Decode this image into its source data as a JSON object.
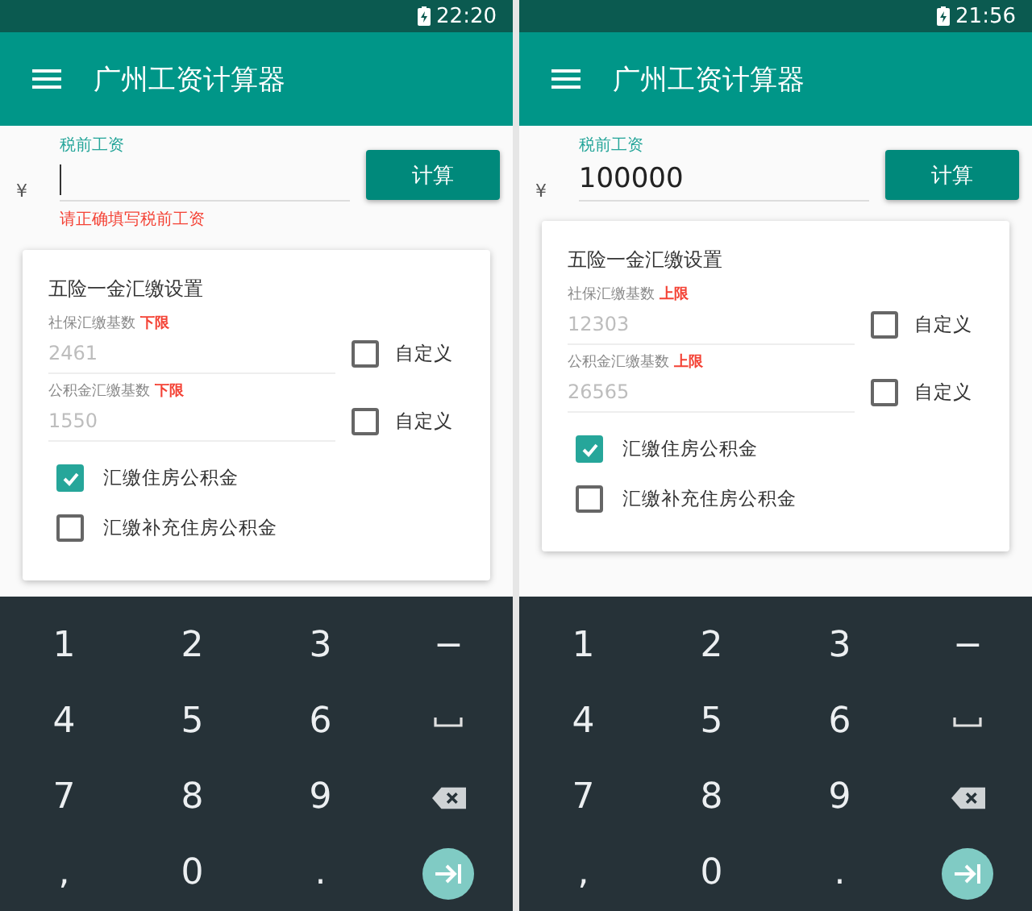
{
  "phones": [
    {
      "status_time": "22:20",
      "app_title": "广州工资计算器",
      "salary": {
        "label": "税前工资",
        "currency": "¥",
        "focused": true,
        "error": "请正确填写税前工资"
      },
      "calculate_button": "计算",
      "settings": {
        "title": "五险一金汇缴设置",
        "bases": [
          {
            "label": "社保汇缴基数",
            "limit": "下限",
            "placeholder": "2461",
            "custom": {
              "label": "自定义",
              "checked": false
            }
          },
          {
            "label": "公积金汇缴基数",
            "limit": "下限",
            "placeholder": "1550",
            "custom": {
              "label": "自定义",
              "checked": false
            }
          }
        ],
        "options": [
          {
            "label": "汇缴住房公积金",
            "checked": true
          },
          {
            "label": "汇缴补充住房公积金",
            "checked": false
          }
        ]
      },
      "keys": [
        {
          "kind": "char",
          "label": "1"
        },
        {
          "kind": "char",
          "label": "2"
        },
        {
          "kind": "char",
          "label": "3"
        },
        {
          "kind": "char",
          "label": "−"
        },
        {
          "kind": "char",
          "label": "4"
        },
        {
          "kind": "char",
          "label": "5"
        },
        {
          "kind": "char",
          "label": "6"
        },
        {
          "kind": "space"
        },
        {
          "kind": "char",
          "label": "7"
        },
        {
          "kind": "char",
          "label": "8"
        },
        {
          "kind": "char",
          "label": "9"
        },
        {
          "kind": "backspace"
        },
        {
          "kind": "char",
          "label": ","
        },
        {
          "kind": "char",
          "label": "0"
        },
        {
          "kind": "char",
          "label": "."
        },
        {
          "kind": "next"
        }
      ]
    },
    {
      "status_time": "21:56",
      "app_title": "广州工资计算器",
      "salary": {
        "label": "税前工资",
        "currency": "¥",
        "value": "100000",
        "focused": false
      },
      "calculate_button": "计算",
      "settings": {
        "title": "五险一金汇缴设置",
        "bases": [
          {
            "label": "社保汇缴基数",
            "limit": "上限",
            "placeholder": "12303",
            "custom": {
              "label": "自定义",
              "checked": false
            }
          },
          {
            "label": "公积金汇缴基数",
            "limit": "上限",
            "placeholder": "26565",
            "custom": {
              "label": "自定义",
              "checked": false
            }
          }
        ],
        "options": [
          {
            "label": "汇缴住房公积金",
            "checked": true
          },
          {
            "label": "汇缴补充住房公积金",
            "checked": false
          }
        ]
      },
      "keys": [
        {
          "kind": "char",
          "label": "1"
        },
        {
          "kind": "char",
          "label": "2"
        },
        {
          "kind": "char",
          "label": "3"
        },
        {
          "kind": "char",
          "label": "−"
        },
        {
          "kind": "char",
          "label": "4"
        },
        {
          "kind": "char",
          "label": "5"
        },
        {
          "kind": "char",
          "label": "6"
        },
        {
          "kind": "space"
        },
        {
          "kind": "char",
          "label": "7"
        },
        {
          "kind": "char",
          "label": "8"
        },
        {
          "kind": "char",
          "label": "9"
        },
        {
          "kind": "backspace"
        },
        {
          "kind": "char",
          "label": ","
        },
        {
          "kind": "char",
          "label": "0"
        },
        {
          "kind": "char",
          "label": "."
        },
        {
          "kind": "next"
        }
      ]
    }
  ]
}
